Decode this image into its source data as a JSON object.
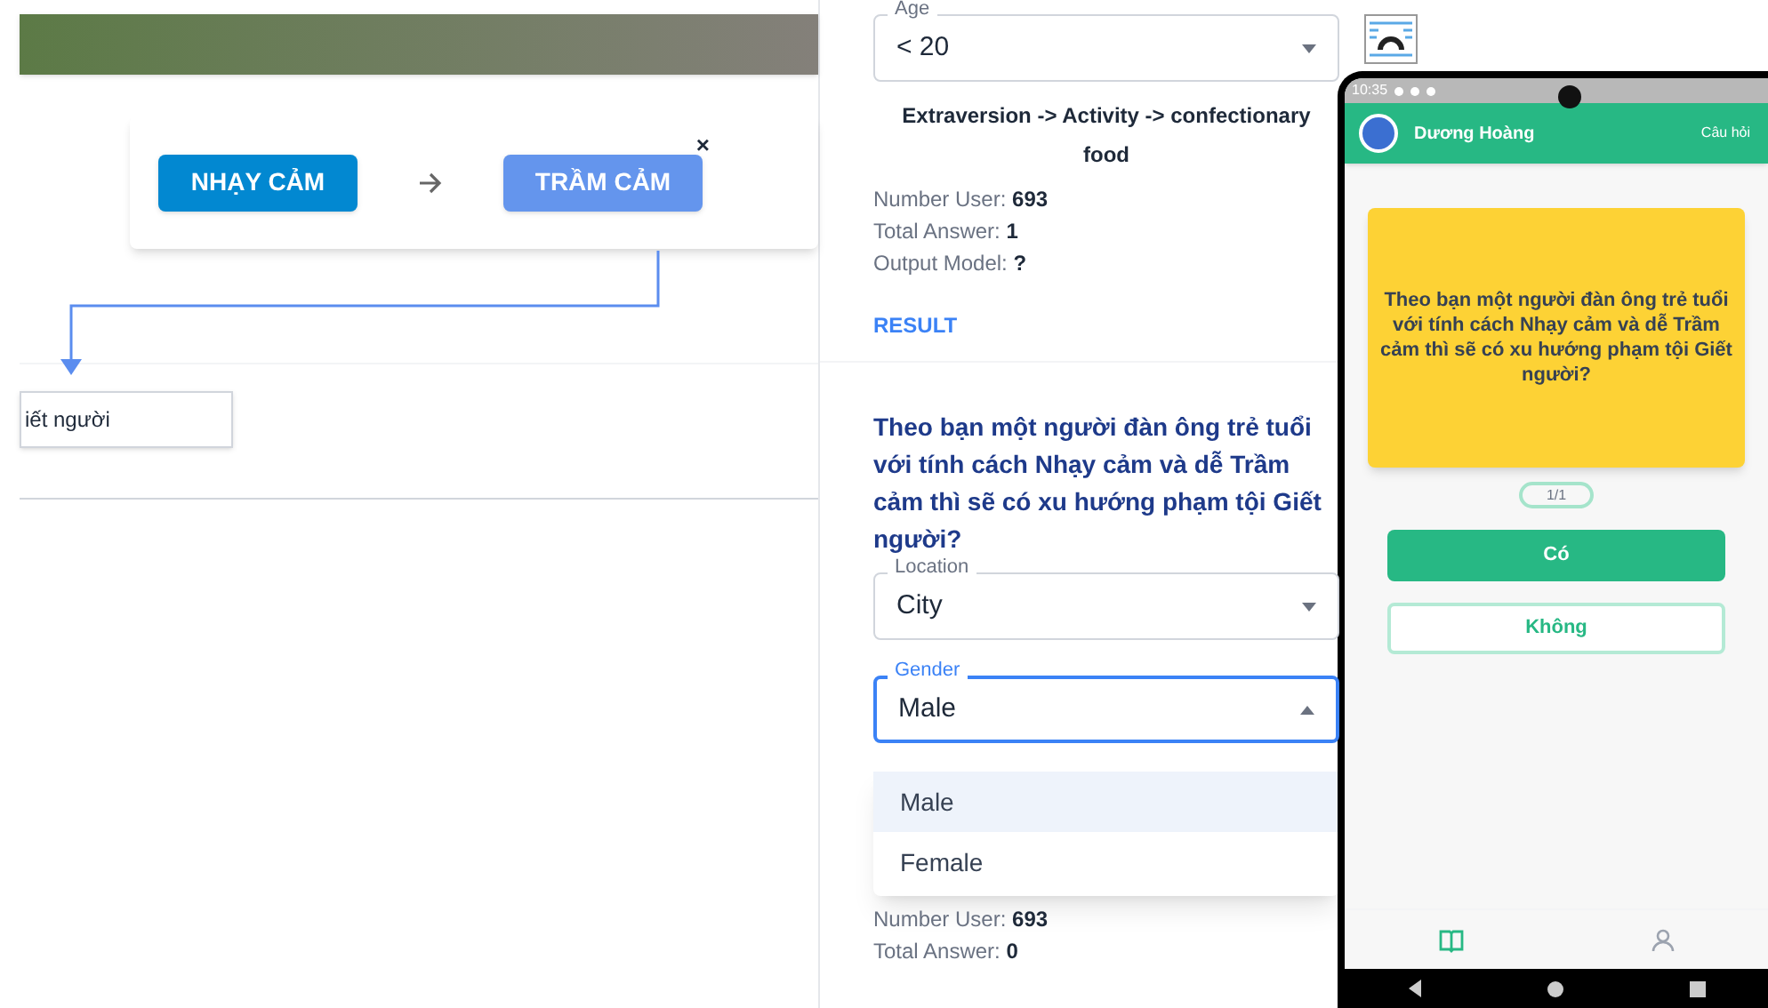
{
  "flow_editor": {
    "nodes": [
      {
        "label": "NHẠY CẢM",
        "color": "#0288d1"
      },
      {
        "label": "TRẦM CẢM",
        "color": "#6495ed",
        "close": "×"
      }
    ],
    "result_node": {
      "label": "iết người"
    }
  },
  "survey_form": {
    "age_field": {
      "label": "Age",
      "value": "< 20"
    },
    "chain": "Extraversion -> Activity -> confectionary food",
    "stats": [
      {
        "label": "Number User:",
        "value": "693"
      },
      {
        "label": "Total Answer:",
        "value": "1"
      },
      {
        "label": "Output Model:",
        "value": "?"
      }
    ],
    "result_link": "RESULT",
    "question": "Theo bạn một người đàn ông trẻ tuổi với tính cách Nhạy cảm và dễ Trầm cảm thì sẽ có xu hướng phạm tội Giết người?",
    "location_field": {
      "label": "Location",
      "value": "City",
      "expanded": false
    },
    "gender_field": {
      "label": "Gender",
      "value": "Male",
      "expanded": true
    },
    "gender_options": [
      {
        "label": "Male",
        "selected": true
      },
      {
        "label": "Female",
        "selected": false
      }
    ],
    "stats_2": [
      {
        "label": "Number User:",
        "value": "693"
      },
      {
        "label": "Total Answer:",
        "value": "0"
      }
    ]
  },
  "phone": {
    "status_time": "10:35",
    "user_name": "Dương Hoàng",
    "header_link": "Câu hỏi",
    "question": "Theo bạn một người đàn ông trẻ tuổi với tính cách Nhạy cảm và dễ Trầm cảm thì sẽ có xu hướng phạm tội Giết người?",
    "counter": "1/1",
    "buttons": [
      {
        "label": "Có",
        "kind": "primary"
      },
      {
        "label": "Không",
        "kind": "outline"
      }
    ],
    "nav": [
      {
        "kind": "book",
        "selected": true
      },
      {
        "kind": "person",
        "selected": false
      }
    ]
  }
}
